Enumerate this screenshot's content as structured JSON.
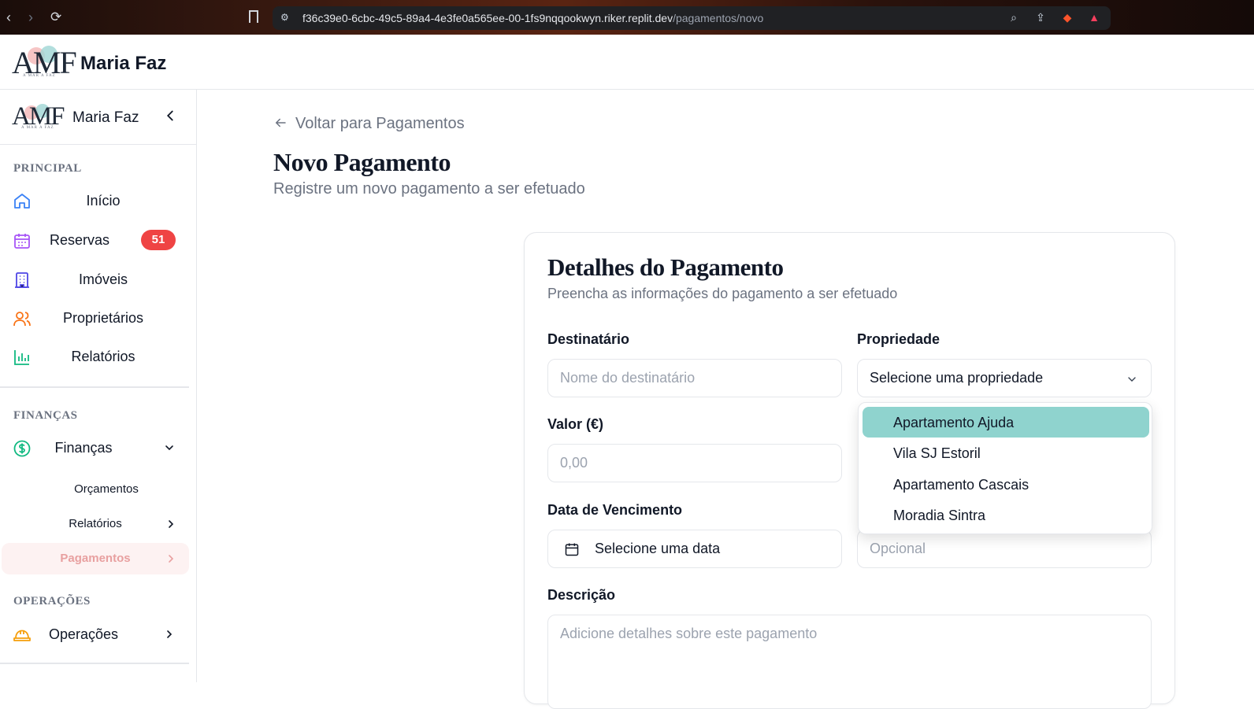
{
  "browser": {
    "url_host": "f36c39e0-6cbc-49c5-89a4-4e3fe0a565ee-00-1fs9nqqookwyn.riker.replit.dev",
    "url_path": "/pagamentos/novo"
  },
  "header": {
    "logo_text": "AMF",
    "logo_subtext": "A MAR A FAZ",
    "brand": "Maria Faz"
  },
  "sidebar": {
    "logo_text": "AMF",
    "logo_subtext": "A MAR A FAZ",
    "brand": "Maria Faz",
    "sections": {
      "principal": "PRINCIPAL",
      "financas": "FINANÇAS",
      "operacoes": "OPERAÇÕES"
    },
    "items": {
      "inicio": "Início",
      "reservas": "Reservas",
      "reservas_badge": "51",
      "imoveis": "Imóveis",
      "proprietarios": "Proprietários",
      "relatorios": "Relatórios",
      "financas": "Finanças",
      "orcamentos": "Orçamentos",
      "fin_relatorios": "Relatórios",
      "pagamentos": "Pagamentos",
      "operacoes": "Operações"
    }
  },
  "main": {
    "back_label": "Voltar para Pagamentos",
    "title": "Novo Pagamento",
    "subtitle": "Registre um novo pagamento a ser efetuado",
    "card": {
      "title": "Detalhes do Pagamento",
      "subtitle": "Preencha as informações do pagamento a ser efetuado",
      "fields": {
        "destinatario_label": "Destinatário",
        "destinatario_placeholder": "Nome do destinatário",
        "propriedade_label": "Propriedade",
        "propriedade_value": "Selecione uma propriedade",
        "valor_label": "Valor (€)",
        "valor_placeholder": "0,00",
        "vencimento_label": "Data de Vencimento",
        "vencimento_value": "Selecione uma data",
        "opcional_placeholder": "Opcional",
        "descricao_label": "Descrição",
        "descricao_placeholder": "Adicione detalhes sobre este pagamento"
      },
      "property_options": [
        "Apartamento Ajuda",
        "Vila SJ Estoril",
        "Apartamento Cascais",
        "Moradia Sintra"
      ],
      "highlighted_option": "Apartamento Ajuda"
    }
  },
  "colors": {
    "badge": "#ef4444",
    "selected_option": "#8fd3ce",
    "active_nav_bg": "#fdf2f2",
    "active_nav_text": "#e8a0a0"
  }
}
